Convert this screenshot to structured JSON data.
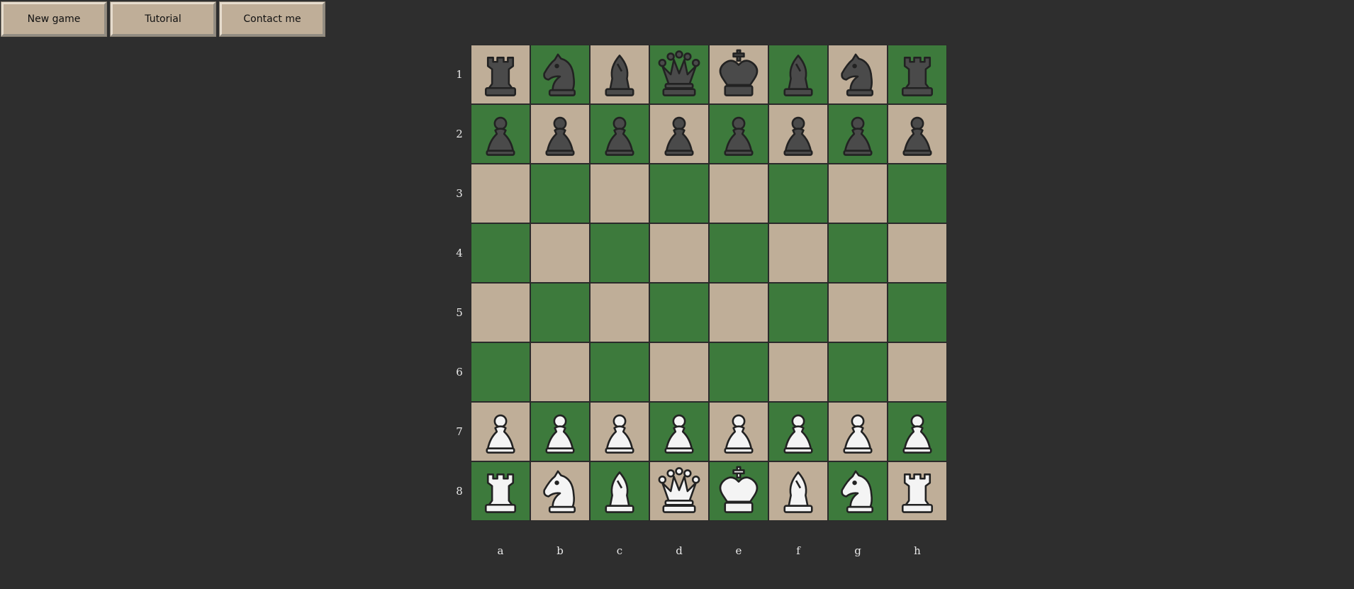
{
  "toolbar": {
    "new_game_label": "New game",
    "tutorial_label": "Tutorial",
    "contact_label": "Contact me"
  },
  "board": {
    "rank_labels": [
      "1",
      "2",
      "3",
      "4",
      "5",
      "6",
      "7",
      "8"
    ],
    "file_labels": [
      "a",
      "b",
      "c",
      "d",
      "e",
      "f",
      "g",
      "h"
    ],
    "light_square_color": "#bfae98",
    "dark_square_color": "#3d7a3c",
    "rows": [
      [
        "black-rook",
        "black-knight",
        "black-bishop",
        "black-queen",
        "black-king",
        "black-bishop",
        "black-knight",
        "black-rook"
      ],
      [
        "black-pawn",
        "black-pawn",
        "black-pawn",
        "black-pawn",
        "black-pawn",
        "black-pawn",
        "black-pawn",
        "black-pawn"
      ],
      [
        "",
        "",
        "",
        "",
        "",
        "",
        "",
        ""
      ],
      [
        "",
        "",
        "",
        "",
        "",
        "",
        "",
        ""
      ],
      [
        "",
        "",
        "",
        "",
        "",
        "",
        "",
        ""
      ],
      [
        "",
        "",
        "",
        "",
        "",
        "",
        "",
        ""
      ],
      [
        "white-pawn",
        "white-pawn",
        "white-pawn",
        "white-pawn",
        "white-pawn",
        "white-pawn",
        "white-pawn",
        "white-pawn"
      ],
      [
        "white-rook",
        "white-knight",
        "white-bishop",
        "white-queen",
        "white-king",
        "white-bishop",
        "white-knight",
        "white-rook"
      ]
    ]
  },
  "colors": {
    "background": "#2e2e2e",
    "black_piece_fill": "#4a4a4a",
    "white_piece_fill": "#f4f4f4",
    "piece_outline": "#222222"
  }
}
